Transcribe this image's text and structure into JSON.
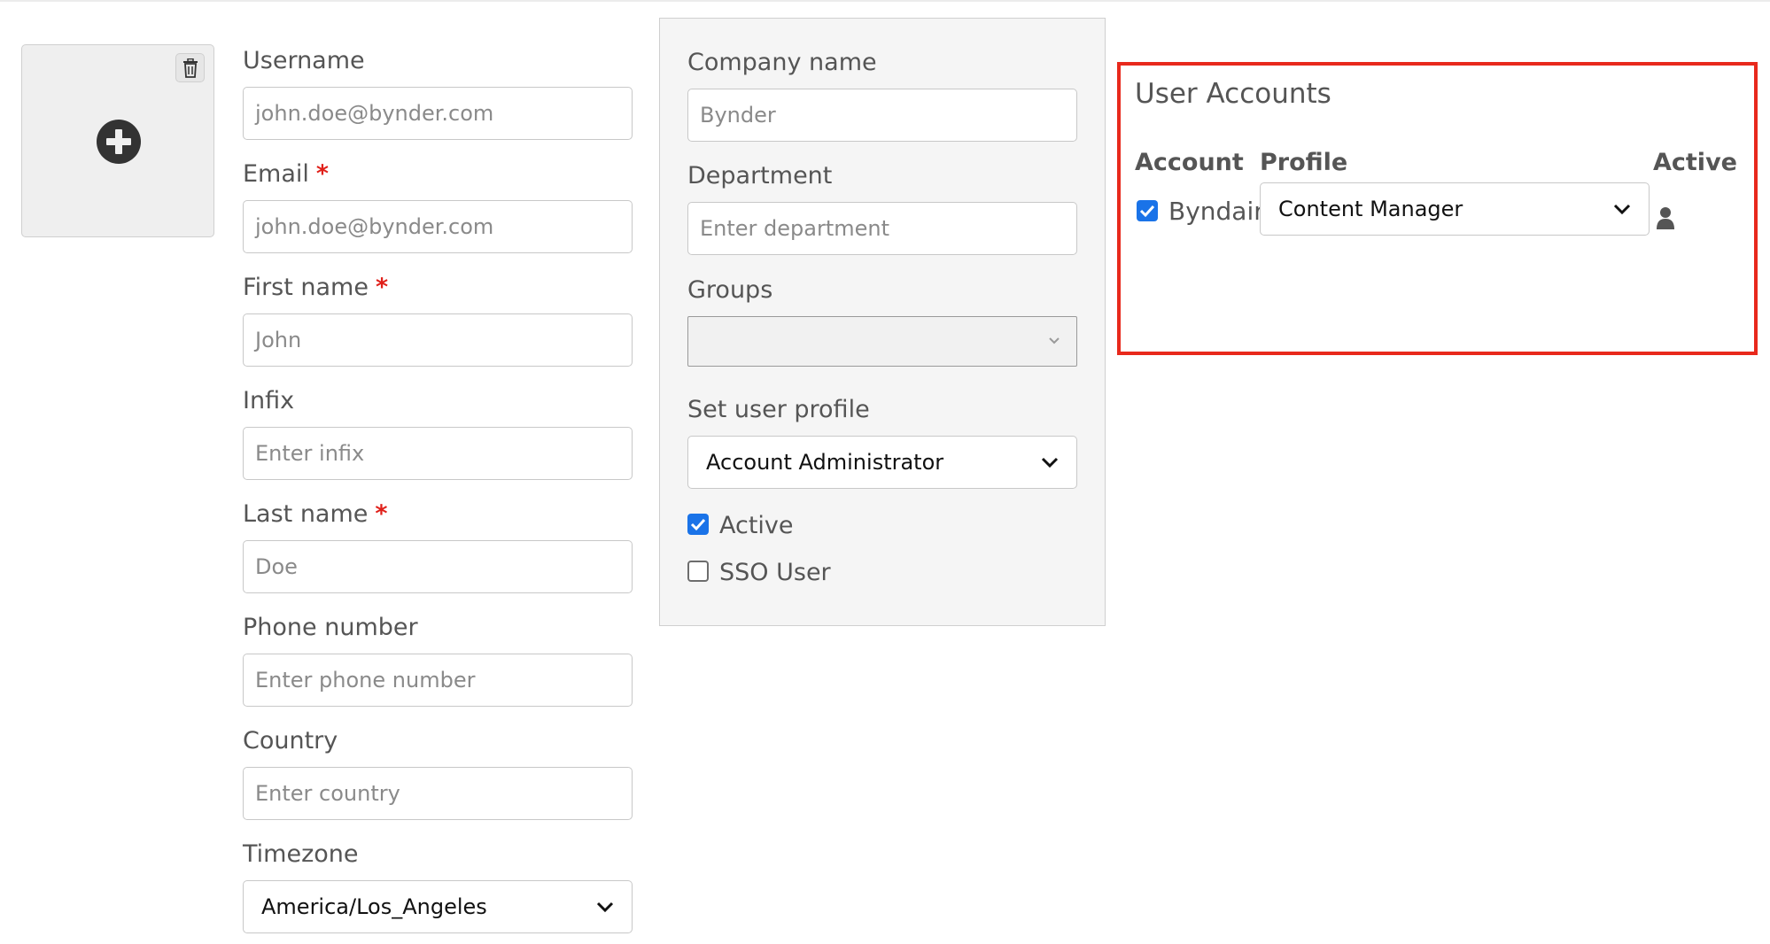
{
  "avatar": {
    "delete_icon": "trash-icon",
    "add_icon": "plus-circle-icon"
  },
  "form": {
    "username": {
      "label": "Username",
      "placeholder": "john.doe@bynder.com"
    },
    "email": {
      "label": "Email",
      "required": "*",
      "placeholder": "john.doe@bynder.com"
    },
    "first_name": {
      "label": "First name",
      "required": "*",
      "placeholder": "John"
    },
    "infix": {
      "label": "Infix",
      "placeholder": "Enter infix"
    },
    "last_name": {
      "label": "Last name",
      "required": "*",
      "placeholder": "Doe"
    },
    "phone": {
      "label": "Phone number",
      "placeholder": "Enter phone number"
    },
    "country": {
      "label": "Country",
      "placeholder": "Enter country"
    },
    "timezone": {
      "label": "Timezone",
      "value": "America/Los_Angeles"
    }
  },
  "panel": {
    "company": {
      "label": "Company name",
      "placeholder": "Bynder"
    },
    "department": {
      "label": "Department",
      "placeholder": "Enter department"
    },
    "groups": {
      "label": "Groups",
      "value": ""
    },
    "profile": {
      "label": "Set user profile",
      "value": "Account Administrator"
    },
    "active": {
      "label": "Active",
      "checked": true
    },
    "sso": {
      "label": "SSO User",
      "checked": false
    }
  },
  "user_accounts": {
    "title": "User Accounts",
    "headers": {
      "account": "Account",
      "profile": "Profile",
      "active": "Active"
    },
    "rows": [
      {
        "checked": true,
        "account": "Byndair",
        "profile": "Content Manager",
        "active_icon": "user-icon"
      }
    ],
    "highlight_color": "#e8291c"
  },
  "colors": {
    "accent": "#1a73e8",
    "required": "#e0201a"
  }
}
